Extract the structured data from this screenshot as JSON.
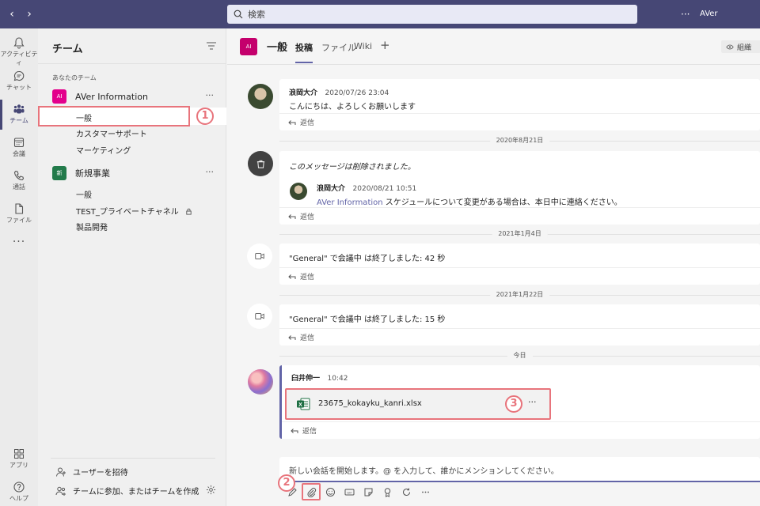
{
  "topbar": {
    "back": "‹",
    "forward": "›",
    "search_placeholder": "検索",
    "more": "···",
    "org_name": "AVer Information",
    "bg_color": "#464775"
  },
  "rail": {
    "items": [
      {
        "label": "アクティビティ",
        "icon": "bell-icon"
      },
      {
        "label": "チャット",
        "icon": "chat-icon"
      },
      {
        "label": "チーム",
        "icon": "teams-icon"
      },
      {
        "label": "会議",
        "icon": "calendar-icon"
      },
      {
        "label": "通話",
        "icon": "phone-icon"
      },
      {
        "label": "ファイル",
        "icon": "file-icon"
      }
    ],
    "more": "···",
    "apps_label": "アプリ",
    "help_label": "ヘルプ"
  },
  "panel": {
    "title": "チーム",
    "section_label": "あなたのチーム",
    "teams": [
      {
        "avatar": "AI",
        "name": "AVer Information",
        "more": "···",
        "color": "#e3008c",
        "channels": [
          "一般",
          "カスタマーサポート",
          "マーケティング"
        ]
      },
      {
        "avatar": "新",
        "name": "新規事業",
        "more": "···",
        "color": "#237b4b",
        "channels": [
          "一般",
          "TEST_プライベートチャネル",
          "製品開発"
        ]
      }
    ],
    "invite_label": "ユーザーを招待",
    "join_label": "チームに参加、またはチームを作成"
  },
  "annotations": {
    "one": "1",
    "two": "2",
    "three": "3",
    "color": "#e8747c"
  },
  "header": {
    "avatar": "AI",
    "title": "一般",
    "tabs": [
      "投稿",
      "ファイル",
      "Wiki"
    ],
    "add_tab": "+",
    "org_button": "組織"
  },
  "messages": {
    "m1": {
      "author": "浪岡大介",
      "time": "2020/07/26 23:04",
      "text": "こんにちは、よろしくお願いします"
    },
    "d1": "2020年8月21日",
    "m2": {
      "deleted_text": "このメッセージは削除されました。",
      "quote_author": "浪岡大介",
      "quote_time": "2020/08/21 10:51",
      "quote_link": "AVer Information",
      "quote_text": " スケジュールについて変更がある場合は、本日中に連絡ください。"
    },
    "d2": "2021年1月4日",
    "m3": {
      "text": "\"General\" で会議中 は終了しました: 42 秒"
    },
    "d3": "2021年1月22日",
    "m4": {
      "text": "\"General\" で会議中 は終了しました: 15 秒"
    },
    "d4": "今日",
    "m5": {
      "author": "臼井伸一",
      "time": "10:42",
      "file_name": "23675_kokayku_kanri.xlsx",
      "file_more": "···"
    },
    "reply": "返信"
  },
  "compose": {
    "placeholder": "新しい会話を開始します。@ を入力して、誰かにメンションしてください。",
    "tools": [
      "format-icon",
      "attach-icon",
      "emoji-icon",
      "gif-icon",
      "sticker-icon",
      "praise-icon",
      "loop-icon",
      "more-icon"
    ]
  }
}
